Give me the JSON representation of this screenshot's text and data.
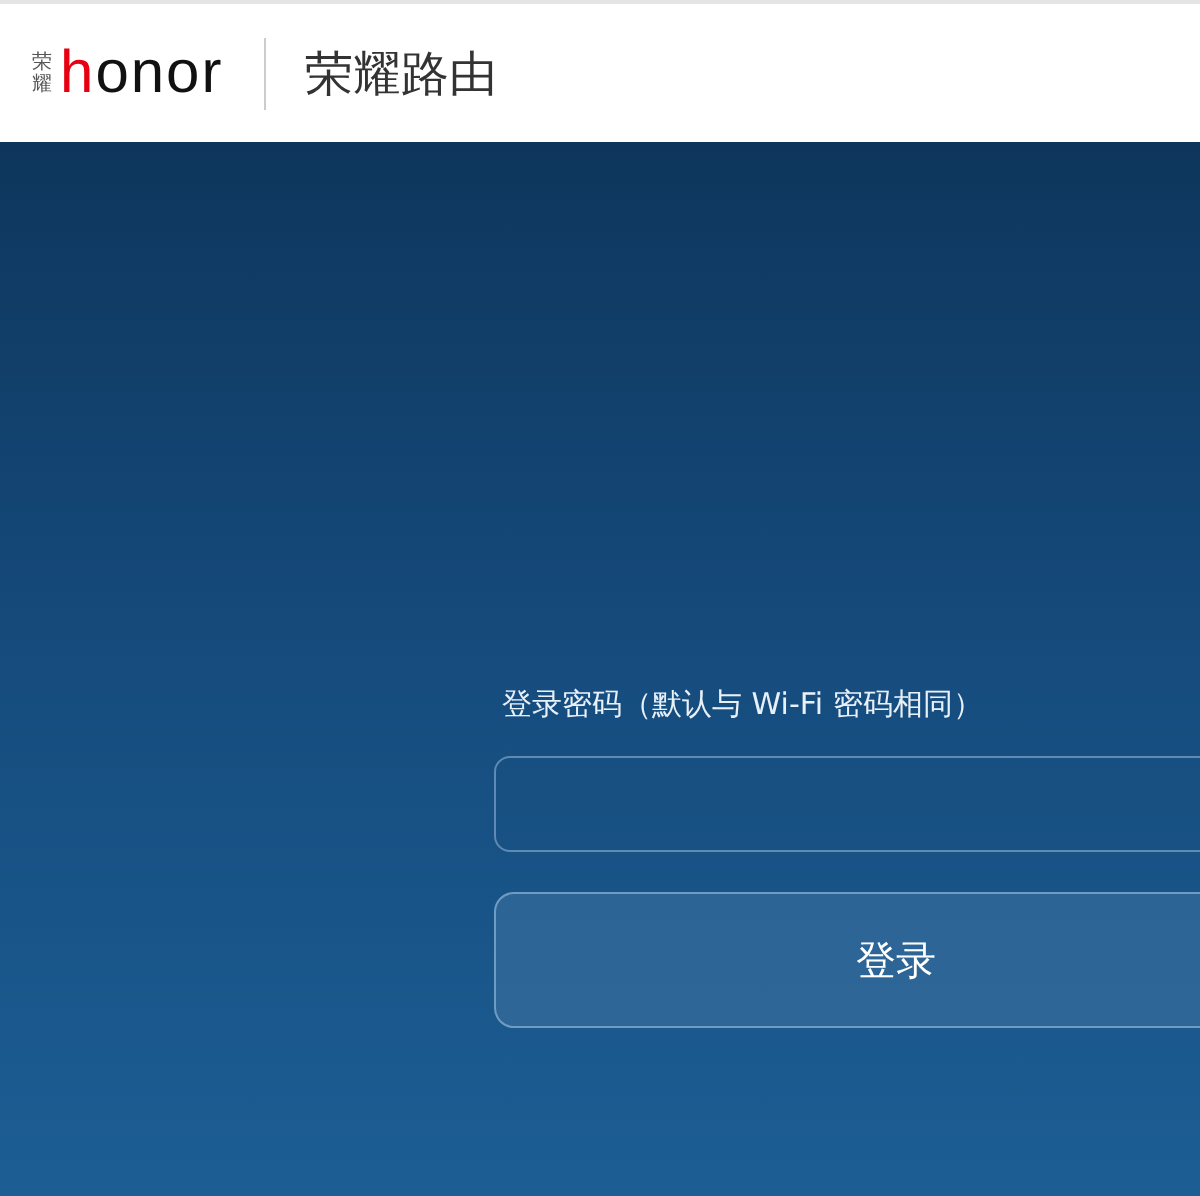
{
  "header": {
    "logo_small": "荣耀",
    "logo_word": "honor",
    "title": "荣耀路由"
  },
  "login": {
    "label": "登录密码（默认与 Wi-Fi 密码相同）",
    "button": "登录"
  }
}
